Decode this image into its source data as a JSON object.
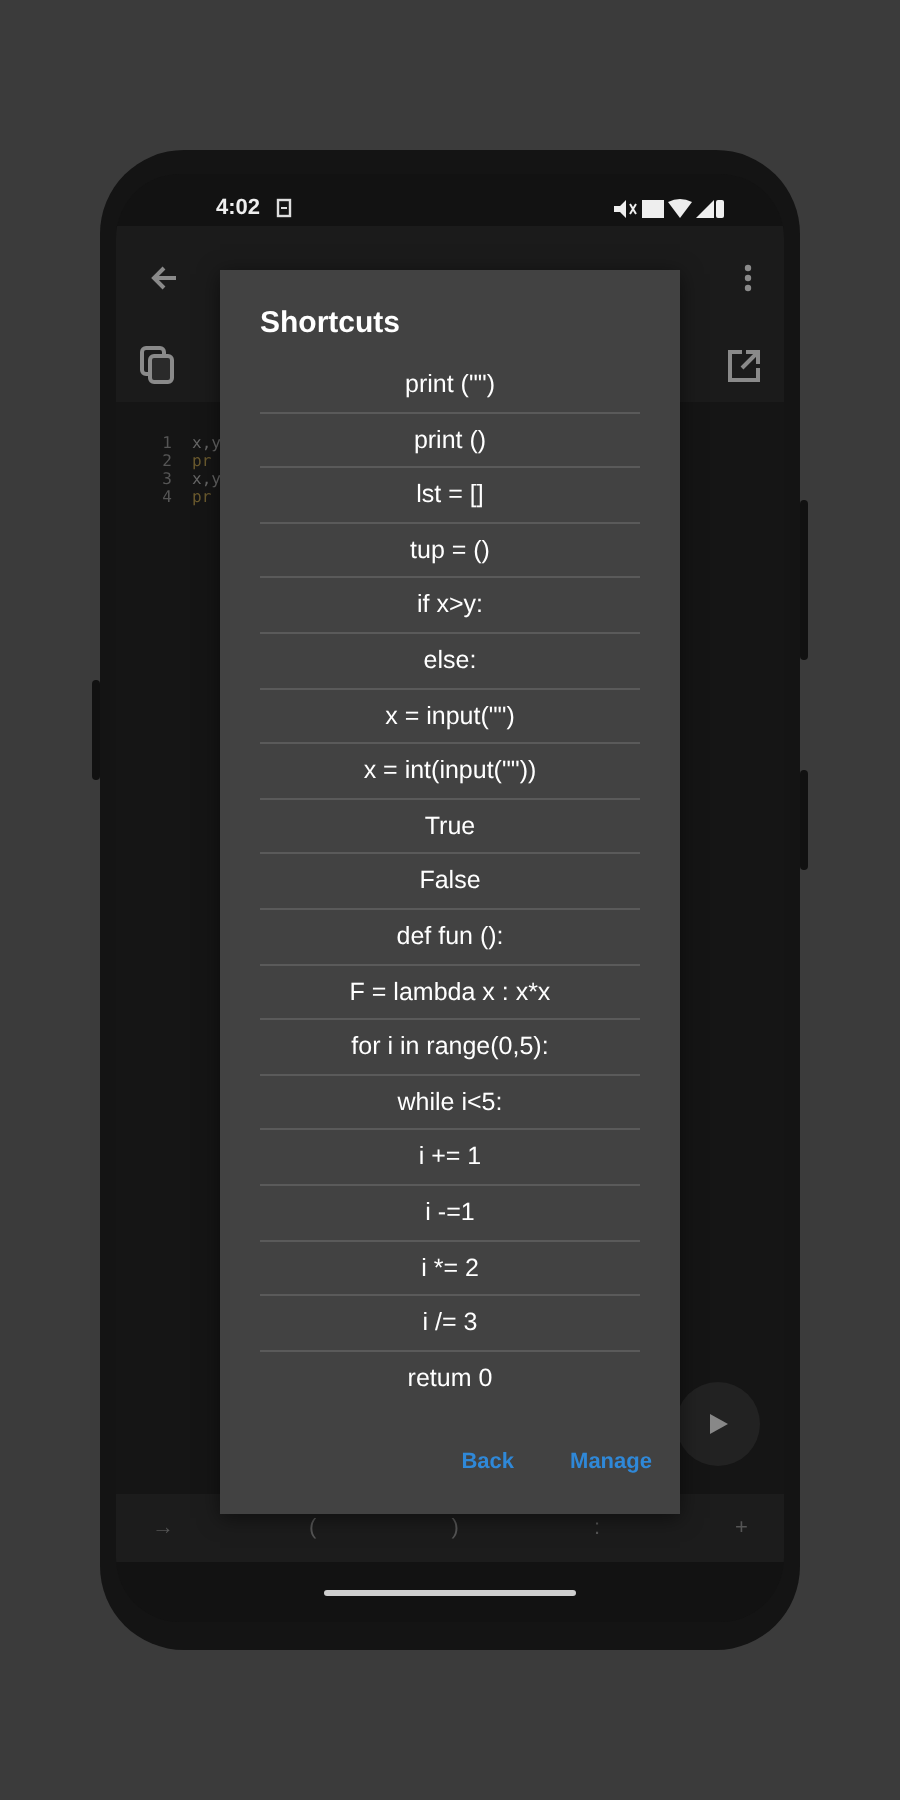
{
  "status_bar": {
    "time": "4:02"
  },
  "editor": {
    "lines": [
      {
        "number": "1",
        "code": "x,y"
      },
      {
        "number": "2",
        "code": "pr"
      },
      {
        "number": "3",
        "code": "x,y"
      },
      {
        "number": "4",
        "code": "pr"
      }
    ]
  },
  "symbol_bar": {
    "keys": [
      "→",
      "(",
      ")",
      ":",
      "+"
    ]
  },
  "dialog": {
    "title": "Shortcuts",
    "items": [
      "print (\"\")",
      "print ()",
      "lst = []",
      "tup = ()",
      "if x>y:",
      "else:",
      "x = input(\"\")",
      "x = int(input(\"\"))",
      "True",
      "False",
      "def fun ():",
      "F = lambda x : x*x",
      "for i in range(0,5):",
      "while i<5:",
      "i += 1",
      "i -=1",
      "i *= 2",
      "i /= 3",
      "retum 0"
    ],
    "buttons": [
      "Back",
      "Manage"
    ]
  }
}
